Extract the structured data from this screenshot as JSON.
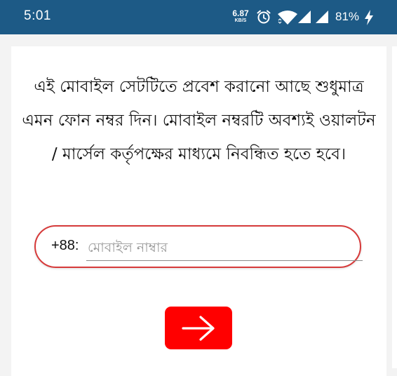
{
  "status_bar": {
    "time": "5:01",
    "net_speed_value": "6.87",
    "net_speed_unit": "KB/S",
    "battery": "81%",
    "icons": [
      "alarm-icon",
      "wifi-icon",
      "signal-icon",
      "signal-icon",
      "charging-bolt-icon"
    ]
  },
  "login": {
    "instructions": "এই মোবাইল সেটটিতে প্রবেশ করানো আছে শুধুমাত্র এমন ফোন নম্বর দিন। মোবাইল নম্বরটি অবশ্যই ওয়ালটন / মার্সেল কর্তৃপক্ষের মাধ্যমে নিবন্ধিত হতে হবে।",
    "country_code": "+88:",
    "phone_value": "",
    "phone_placeholder": "মোবাইল নাম্বার",
    "submit_icon": "arrow-right-icon",
    "accent_color": "#ff0000",
    "field_border_color": "#d63a3a"
  },
  "colors": {
    "status_bar": "#1d5a86",
    "background": "#f3f3f3",
    "card": "#ffffff"
  }
}
